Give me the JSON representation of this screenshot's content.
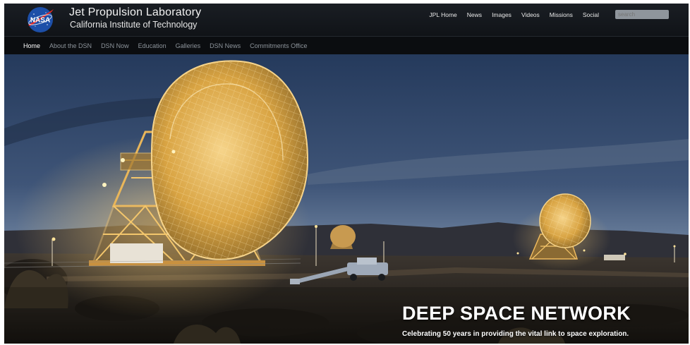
{
  "header": {
    "title": "Jet Propulsion Laboratory",
    "subtitle": "California Institute of Technology",
    "logo_text": "NASA",
    "logo_icon": "nasa-meatball-icon",
    "top_links": [
      "JPL Home",
      "News",
      "Images",
      "Videos",
      "Missions",
      "Social"
    ],
    "search": {
      "value": "",
      "placeholder": "search"
    }
  },
  "nav": {
    "items": [
      "Home",
      "About the DSN",
      "DSN Now",
      "Education",
      "Galleries",
      "DSN News",
      "Commitments Office"
    ],
    "active": "Home"
  },
  "hero": {
    "headline": "DEEP SPACE NETWORK",
    "subline": "Celebrating 50 years in providing the vital link to space exploration."
  },
  "colors": {
    "topbar": "#14181d",
    "navbar": "#0b0d10",
    "nav_text": "#8d949b",
    "sky": "#3f5578",
    "antenna_glow": "#d9a443"
  }
}
